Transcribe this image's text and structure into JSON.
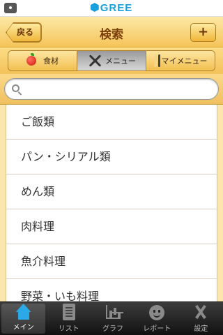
{
  "status_bar": {
    "brand": "GREE"
  },
  "nav": {
    "back_label": "戻る",
    "title": "検索",
    "add_label": "+"
  },
  "segments": [
    {
      "label": "食材",
      "icon": "apple-icon",
      "selected": false
    },
    {
      "label": "メニュー",
      "icon": "utensils-icon",
      "selected": true
    },
    {
      "label": "マイメニュー",
      "icon": "my-utensils-icon",
      "selected": false
    }
  ],
  "search": {
    "value": "",
    "placeholder": ""
  },
  "list": {
    "items": [
      "ご飯類",
      "パン・シリアル類",
      "めん類",
      "肉料理",
      "魚介料理",
      "野菜・いも料理"
    ]
  },
  "tabs": [
    {
      "label": "メイン",
      "icon": "home-icon",
      "active": true
    },
    {
      "label": "リスト",
      "icon": "list-icon",
      "active": false
    },
    {
      "label": "グラフ",
      "icon": "graph-icon",
      "active": false
    },
    {
      "label": "レポート",
      "icon": "report-icon",
      "active": false
    },
    {
      "label": "設定",
      "icon": "settings-icon",
      "active": false
    }
  ],
  "colors": {
    "accent": "#f3c259",
    "brand": "#19a0dc",
    "tab_active_icon": "#2aa8e8"
  }
}
